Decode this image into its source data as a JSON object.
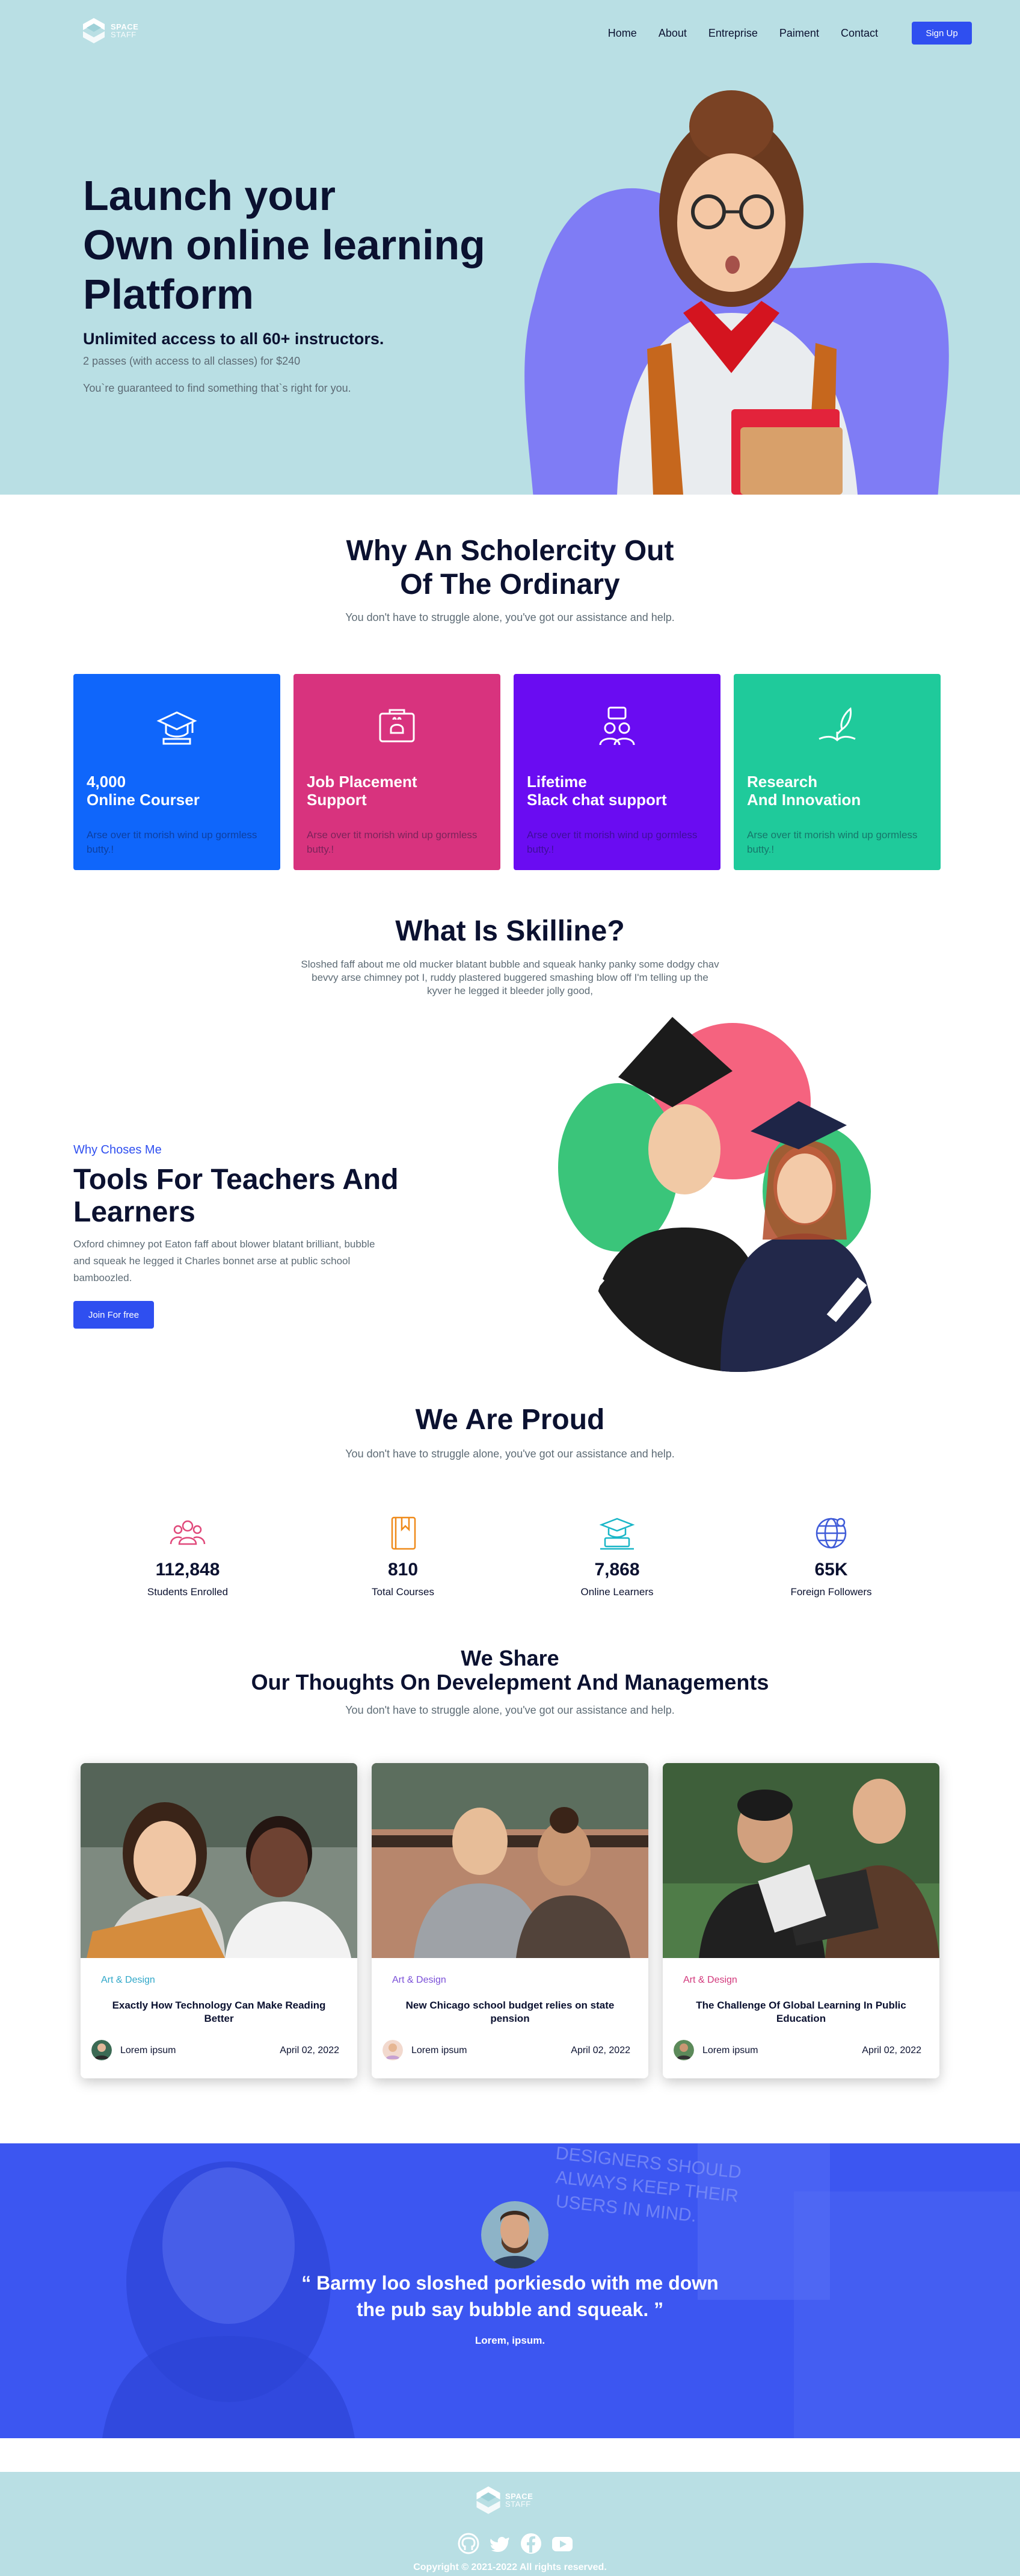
{
  "brand": {
    "line1": "SPACE",
    "line2": "STAFF",
    "icon": "space-staff-logo-icon"
  },
  "nav": {
    "items": [
      "Home",
      "About",
      "Entreprise",
      "Paiment",
      "Contact"
    ],
    "signup": "Sign Up"
  },
  "hero": {
    "title": "Launch your\nOwn online learning\nPlatform",
    "subtitle": "Unlimited access to all 60+ instructors.",
    "line1": "2 passes (with access to all classes) for $240",
    "line2": "You`re guaranteed to find something that`s right for you."
  },
  "why": {
    "title": "Why An Scholercity Out\nOf The Ordinary",
    "subtitle": "You don't have to struggle alone, you've got our assistance and help.",
    "cards": [
      {
        "title": "4,000\nOnline Courser",
        "desc": "Arse over tit morish wind up gormless butty.!",
        "color": "#0f66fb",
        "icon": "graduation-cap-icon"
      },
      {
        "title": "Job Placement\nSupport",
        "desc": "Arse over tit morish wind up gormless butty.!",
        "color": "#d8337e",
        "icon": "briefcase-icon"
      },
      {
        "title": "Lifetime\nSlack chat support",
        "desc": "Arse over tit morish wind up gormless butty.!",
        "color": "#6a0cf2",
        "icon": "chat-users-icon"
      },
      {
        "title": "Research\nAnd Innovation",
        "desc": "Arse over tit morish wind up gormless butty.!",
        "color": "#1fca9b",
        "icon": "book-feather-icon"
      }
    ]
  },
  "what": {
    "title": "What Is Skilline?",
    "subtitle": "Sloshed faff about me old mucker blatant bubble and squeak hanky panky some dodgy chav bevvy arse chimney pot I, ruddy plastered buggered smashing blow off I'm telling up the kyver he legged it bleeder jolly good,",
    "eyebrow": "Why Choses Me",
    "heading": "Tools For Teachers And Learners",
    "desc": "Oxford chimney pot Eaton faff about blower blatant brilliant, bubble and squeak he legged it Charles bonnet arse at public school bamboozled.",
    "button": "Join For free"
  },
  "proud": {
    "title": "We Are Proud",
    "subtitle": "You don't have to struggle alone, you've got our assistance and help.",
    "stats": [
      {
        "value": "112,848",
        "label": "Students Enrolled",
        "icon": "users-icon",
        "color": "#e0487a"
      },
      {
        "value": "810",
        "label": "Total Courses",
        "icon": "book-icon",
        "color": "#ef8a1a"
      },
      {
        "value": "7,868",
        "label": "Online Learners",
        "icon": "laptop-cap-icon",
        "color": "#19b6c7"
      },
      {
        "value": "65K",
        "label": "Foreign Followers",
        "icon": "globe-icon",
        "color": "#3f5bd8"
      }
    ]
  },
  "blog": {
    "title": "We Share\nOur Thoughts On Develepment And Managements",
    "subtitle": "You don't have to struggle alone, you've got our assistance and help.",
    "posts": [
      {
        "category": "Art & Design",
        "category_color": "#2fa7c9",
        "title": "Exactly How Technology Can Make Reading Better",
        "author": "Lorem ipsum",
        "date": "April 02, 2022"
      },
      {
        "category": "Art & Design",
        "category_color": "#7a4fd8",
        "title": "New Chicago school budget relies on state pension",
        "author": "Lorem ipsum",
        "date": "April 02, 2022"
      },
      {
        "category": "Art & Design",
        "category_color": "#d2377b",
        "title": "The Challenge Of Global Learning In Public Education",
        "author": "Lorem ipsum",
        "date": "April 02, 2022"
      }
    ]
  },
  "testimonial": {
    "quote": "“ Barmy loo sloshed porkiesdo with me down\nthe pub say bubble and squeak. ”",
    "author": "Lorem, ipsum.",
    "bg_text": "DESIGNERS SHOULD\nALWAYS KEEP THEIR\nUSERS IN MIND."
  },
  "footer": {
    "copyright": "Copyright © 2021-2022 All rights reserved.",
    "socials": [
      "github-icon",
      "twitter-icon",
      "facebook-icon",
      "youtube-icon"
    ]
  }
}
